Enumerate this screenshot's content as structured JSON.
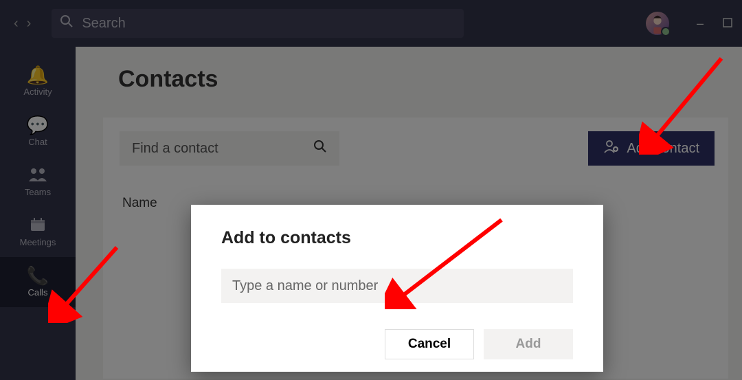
{
  "search": {
    "placeholder": "Search"
  },
  "sidebar": {
    "items": [
      {
        "label": "Activity"
      },
      {
        "label": "Chat"
      },
      {
        "label": "Teams"
      },
      {
        "label": "Meetings"
      },
      {
        "label": "Calls"
      }
    ]
  },
  "page": {
    "title": "Contacts",
    "find_placeholder": "Find a contact",
    "add_contact_label": "Add contact",
    "column_name": "Name"
  },
  "modal": {
    "title": "Add to contacts",
    "placeholder": "Type a name or number",
    "cancel": "Cancel",
    "add": "Add"
  }
}
